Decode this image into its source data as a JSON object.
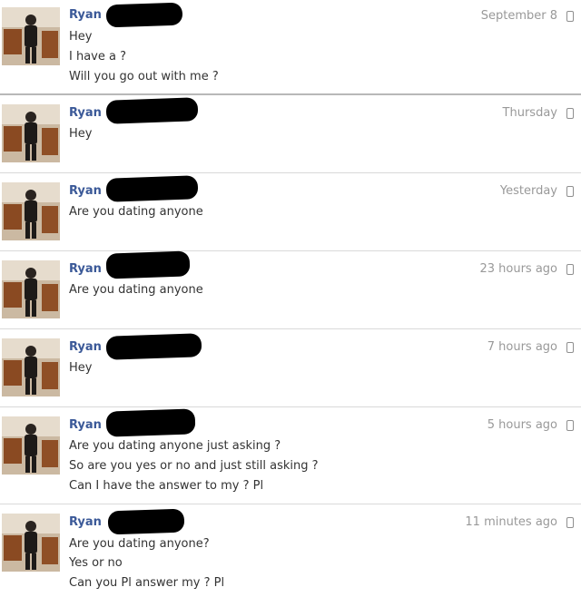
{
  "messages": [
    {
      "name": "Ryan",
      "time": "September 8",
      "lines": [
        "Hey",
        "I have a ?",
        "Will you go out with me ?"
      ]
    },
    {
      "name": "Ryan",
      "time": "Thursday",
      "lines": [
        "Hey"
      ]
    },
    {
      "name": "Ryan",
      "time": "Yesterday",
      "lines": [
        "Are you dating anyone"
      ]
    },
    {
      "name": "Ryan",
      "time": "23 hours ago",
      "lines": [
        "Are you dating anyone"
      ]
    },
    {
      "name": "Ryan",
      "time": "7 hours ago",
      "lines": [
        "Hey"
      ]
    },
    {
      "name": "Ryan",
      "time": "5 hours ago",
      "lines": [
        "Are you dating anyone just asking ?",
        "So are you yes or no and just still asking ?",
        "Can I have the answer to my ? Pl"
      ]
    },
    {
      "name": "Ryan",
      "time": "11 minutes ago",
      "lines": [
        "Are you dating anyone?",
        "Yes or no",
        "Can you Pl answer my ? Pl"
      ]
    }
  ],
  "icons": {
    "avatar": "profile-photo",
    "device": "mobile-phone-icon"
  }
}
